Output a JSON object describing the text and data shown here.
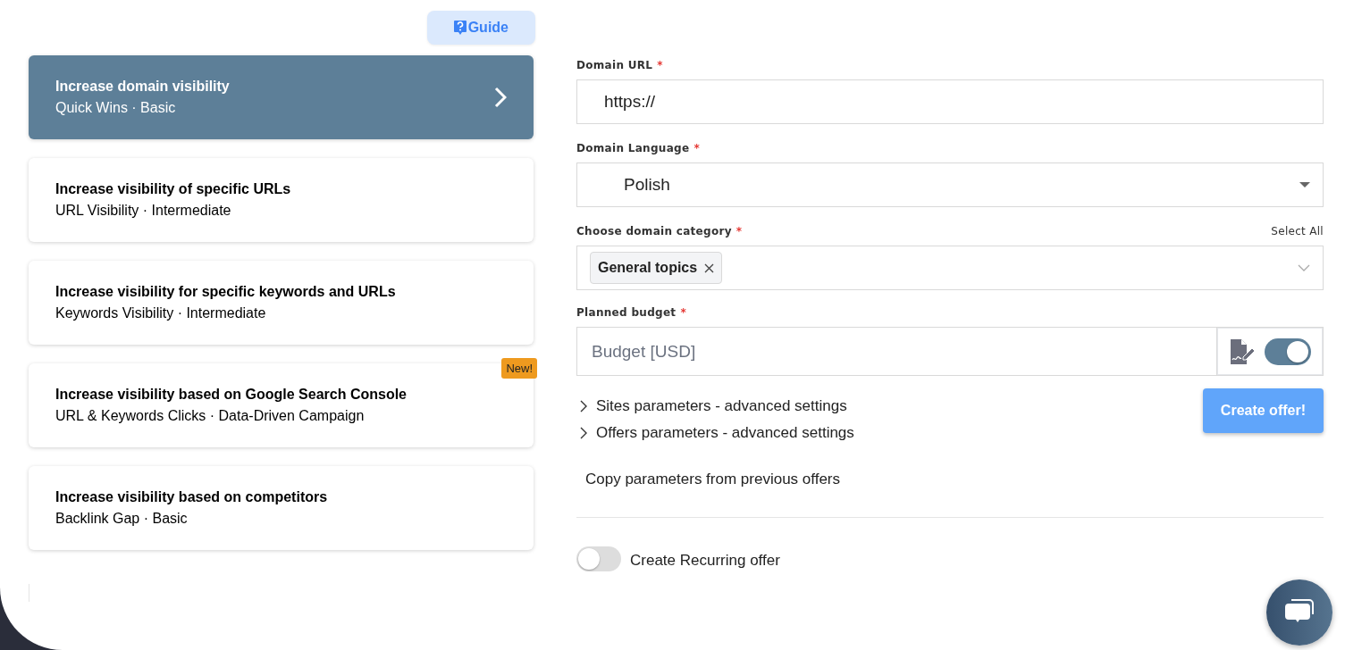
{
  "guide_button": {
    "label": "Guide"
  },
  "goals": [
    {
      "title": "Increase domain visibility",
      "subtitle": "Quick Wins · Basic",
      "selected": true
    },
    {
      "title": "Increase visibility of specific URLs",
      "subtitle": "URL Visibility · Intermediate",
      "selected": false
    },
    {
      "title": "Increase visibility for specific keywords and URLs",
      "subtitle": "Keywords Visibility · Intermediate",
      "selected": false
    },
    {
      "title": "Increase visibility based on Google Search Console",
      "subtitle": "URL & Keywords Clicks · Data-Driven Campaign",
      "selected": false,
      "badge": "New!"
    },
    {
      "title": "Increase visibility based on competitors",
      "subtitle": "Backlink Gap · Basic",
      "selected": false
    }
  ],
  "form": {
    "domain_url": {
      "label": "Domain URL",
      "marker": "*",
      "value": "https://"
    },
    "domain_language": {
      "label": "Domain Language",
      "marker": "*",
      "value": "Polish"
    },
    "domain_category": {
      "label": "Choose domain category",
      "marker": "*",
      "select_all": "Select All",
      "tags": [
        {
          "label": "General topics"
        }
      ]
    },
    "planned_budget": {
      "label": "Planned budget",
      "marker": "*",
      "placeholder": "Budget [USD]",
      "toggle_on": true
    },
    "advanced": [
      {
        "label": "Sites parameters - advanced settings",
        "expanded": false
      },
      {
        "label": "Offers parameters - advanced settings",
        "expanded": false
      }
    ],
    "create_button": "Create offer!",
    "copy_link": "Copy parameters from previous offers",
    "recurring": {
      "label": "Create Recurring offer",
      "on": false
    }
  }
}
